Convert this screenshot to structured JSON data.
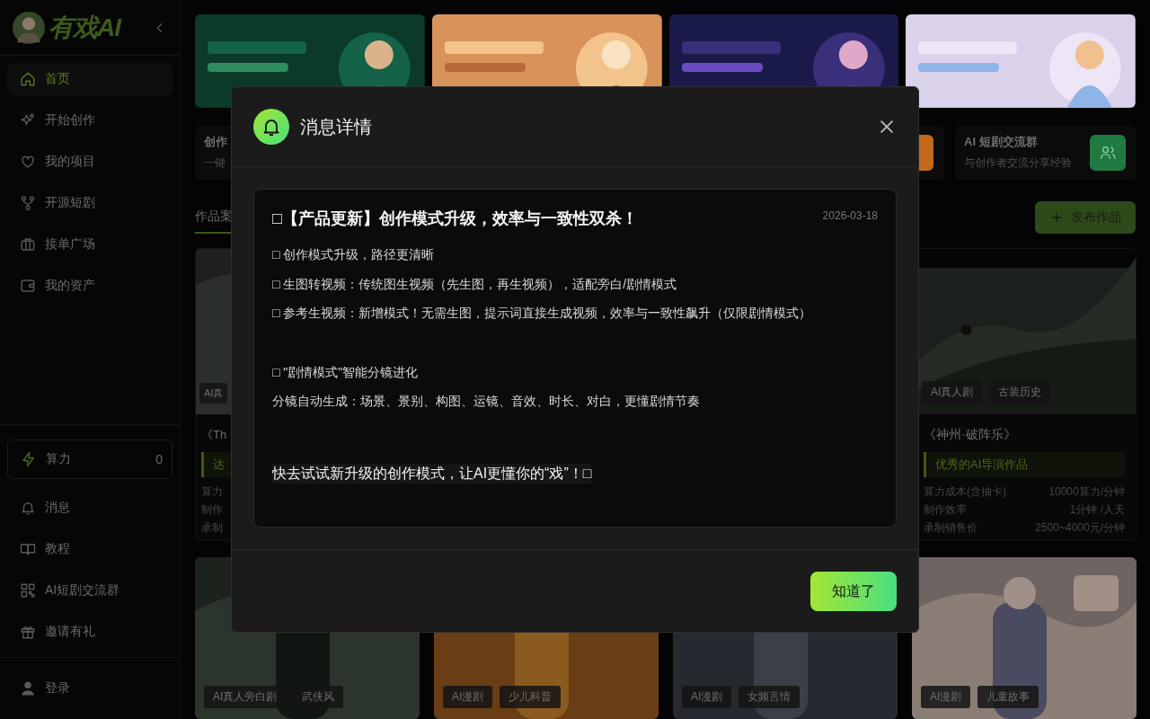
{
  "sidebar": {
    "logo": "有戏AI",
    "nav": [
      {
        "label": "首页",
        "selected": true
      },
      {
        "label": "开始创作",
        "selected": false
      },
      {
        "label": "我的项目",
        "selected": false
      },
      {
        "label": "开源短剧",
        "selected": false
      },
      {
        "label": "接单广场",
        "selected": false
      },
      {
        "label": "我的资产",
        "selected": false
      }
    ],
    "power": {
      "label": "算力",
      "value": "0"
    },
    "links": [
      {
        "label": "消息"
      },
      {
        "label": "教程"
      },
      {
        "label": "AI短剧交流群"
      },
      {
        "label": "邀请有礼"
      }
    ],
    "login": "登录"
  },
  "features": [
    {
      "kind": "text",
      "title": "创作",
      "subtitle": "一键"
    },
    {
      "kind": "icon",
      "color": "#c2691a"
    },
    {
      "kind": "full",
      "title": "AI 短剧交流群",
      "subtitle": "与创作者交流分享经验",
      "color": "#1f7a3f"
    }
  ],
  "tabs": [
    {
      "label": "作品案",
      "selected": true
    }
  ],
  "publish_button": "发布作品",
  "works": [
    {
      "tags": [
        "AI真"
      ],
      "title": "《Th",
      "badge": "达",
      "rows": [
        {
          "label": "算力"
        },
        {
          "label": "制作"
        },
        {
          "label": "承制"
        }
      ]
    },
    {
      "tags": [
        "AI真人剧",
        "古装历史"
      ],
      "title": "《神州·破阵乐》",
      "badge": "优秀的AI导演作品",
      "rows": [
        {
          "label": "算力成本(含抽卡)",
          "value": "10000算力/分钟"
        },
        {
          "label": "制作效率",
          "value": "1分钟 /人天"
        },
        {
          "label": "承制销售价",
          "value": "2500~4000元/分钟"
        }
      ]
    }
  ],
  "works_row2": [
    {
      "tags": [
        "AI真人旁白剧",
        "武侠风"
      ]
    },
    {
      "tags": [
        "AI漫剧",
        "少儿科普"
      ]
    },
    {
      "tags": [
        "AI漫剧",
        "女频言情"
      ]
    },
    {
      "tags": [
        "AI漫剧",
        "儿童故事"
      ]
    }
  ],
  "modal": {
    "title": "消息详情",
    "message_title": "□【产品更新】创作模式升级，效率与一致性双杀！",
    "date": "2026-03-18",
    "lines": [
      {
        "kind": "line",
        "text": "□ 创作模式升级，路径更清晰"
      },
      {
        "kind": "line",
        "text": "□ 生图转视频：传统图生视频（先生图，再生视频），适配旁白/剧情模式"
      },
      {
        "kind": "line",
        "text": "□ 参考生视频：新增模式！无需生图，提示词直接生成视频，效率与一致性飙升（仅限剧情模式）"
      },
      {
        "kind": "gap"
      },
      {
        "kind": "line",
        "text": "□ \"剧情模式\"智能分镜进化"
      },
      {
        "kind": "line",
        "text": "分镜自动生成：场景、景别、构图、运镜、音效、时长、对白，更懂剧情节奏"
      },
      {
        "kind": "gap"
      },
      {
        "kind": "highlight",
        "text": "快去试试新升级的创作模式，让AI更懂你的“戏”！□"
      }
    ],
    "confirm_button": "知道了"
  }
}
